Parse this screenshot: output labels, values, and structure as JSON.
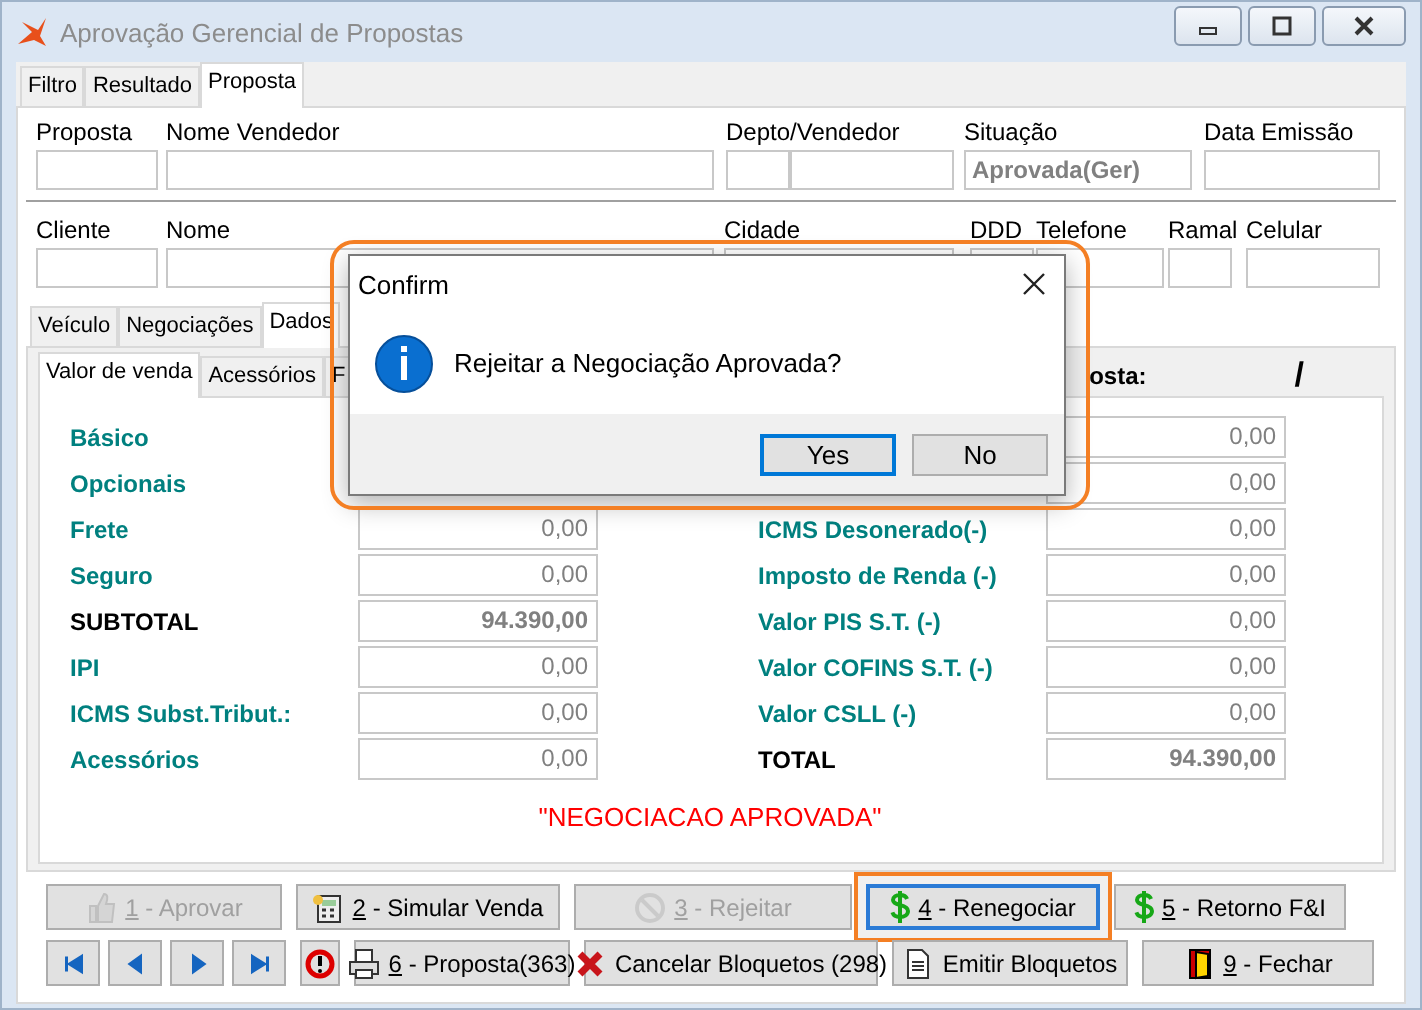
{
  "window": {
    "title": "Aprovação Gerencial de Propostas"
  },
  "tabs": [
    {
      "label": "Filtro",
      "selected": false
    },
    {
      "label": "Resultado",
      "selected": false
    },
    {
      "label": "Proposta",
      "selected": true
    }
  ],
  "header_row_1": [
    {
      "label": "Proposta"
    },
    {
      "label": "Nome Vendedor"
    },
    {
      "label": "Depto/Vendedor",
      "kind": "split"
    },
    {
      "label": "Situação",
      "value": "Aprovada(Ger)"
    },
    {
      "label": "Data Emissão"
    }
  ],
  "header_row_2": [
    {
      "label": "Cliente"
    },
    {
      "label": "Nome"
    },
    {
      "label": "Cidade"
    },
    {
      "label": "DDD"
    },
    {
      "label": "Telefone"
    },
    {
      "label": "Ramal"
    },
    {
      "label": "Celular"
    }
  ],
  "detail_tabs": [
    {
      "label": "Veículo",
      "selected": false
    },
    {
      "label": "Negociações",
      "selected": false
    },
    {
      "label": "Dados",
      "selected": true
    }
  ],
  "sub_tabs": [
    {
      "label": "Valor de venda",
      "selected": true
    },
    {
      "label": "Acessórios",
      "selected": false
    },
    {
      "label": "F",
      "selected": false
    }
  ],
  "proposal_label": "osta:",
  "proposal_separator": "/",
  "values_left": [
    {
      "label": "Básico",
      "kind": "normal"
    },
    {
      "label": "Opcionais",
      "kind": "normal"
    },
    {
      "label": "Frete",
      "value": "0,00",
      "kind": "normal"
    },
    {
      "label": "Seguro",
      "value": "0,00",
      "kind": "normal"
    },
    {
      "label": "SUBTOTAL",
      "value": "94.390,00",
      "kind": "total"
    },
    {
      "label": "IPI",
      "value": "0,00",
      "kind": "normal"
    },
    {
      "label": "ICMS Subst.Tribut.:",
      "value": "0,00",
      "kind": "normal"
    },
    {
      "label": "Acessórios",
      "value": "0,00",
      "kind": "normal"
    }
  ],
  "values_right": [
    {
      "value": "0,00",
      "kind": "normal"
    },
    {
      "value": "0,00",
      "kind": "normal"
    },
    {
      "label": "ICMS Desonerado(-)",
      "value": "0,00",
      "kind": "normal"
    },
    {
      "label": "Imposto de Renda (-)",
      "value": "0,00",
      "kind": "normal"
    },
    {
      "label": "Valor PIS S.T. (-)",
      "value": "0,00",
      "kind": "normal"
    },
    {
      "label": "Valor COFINS S.T. (-)",
      "value": "0,00",
      "kind": "normal"
    },
    {
      "label": "Valor CSLL (-)",
      "value": "0,00",
      "kind": "normal"
    },
    {
      "label": "TOTAL",
      "value": "94.390,00",
      "kind": "total"
    }
  ],
  "status_message": "\"NEGOCIACAO APROVADA\"",
  "buttons_row_1": [
    {
      "key": "1",
      "label": " - Aprovar",
      "disabled": true,
      "focused": false,
      "highlighted": false
    },
    {
      "key": "2",
      "label": " - Simular Venda",
      "disabled": false,
      "focused": false,
      "highlighted": false
    },
    {
      "key": "3",
      "label": " - Rejeitar",
      "disabled": true,
      "focused": false,
      "highlighted": false
    },
    {
      "key": "4",
      "label": " - Renegociar",
      "disabled": false,
      "focused": true,
      "highlighted": true
    },
    {
      "key": "5",
      "label": " - Retorno F&I",
      "disabled": false,
      "focused": false,
      "highlighted": false
    }
  ],
  "nav_buttons": [
    {
      "kind": "first"
    },
    {
      "kind": "prev"
    },
    {
      "kind": "next"
    },
    {
      "kind": "last"
    }
  ],
  "buttons_row_2": [
    {
      "disabled": false,
      "focused": false,
      "highlighted": false
    },
    {
      "key": "6",
      "label": " - Proposta(363)",
      "disabled": false,
      "focused": false,
      "highlighted": false
    },
    {
      "label": "Cancelar Bloquetos (298)",
      "disabled": false,
      "focused": false,
      "highlighted": false
    },
    {
      "label": "Emitir Bloquetos",
      "disabled": false,
      "focused": false,
      "highlighted": false
    },
    {
      "key": "9",
      "label": " - Fechar",
      "disabled": false,
      "focused": false,
      "highlighted": false
    }
  ],
  "dialog": {
    "title": "Confirm",
    "message": "Rejeitar a Negociação Aprovada?",
    "highlighted": true,
    "buttons": [
      {
        "label": "Yes",
        "focused": true
      },
      {
        "label": "No",
        "focused": false
      }
    ]
  }
}
